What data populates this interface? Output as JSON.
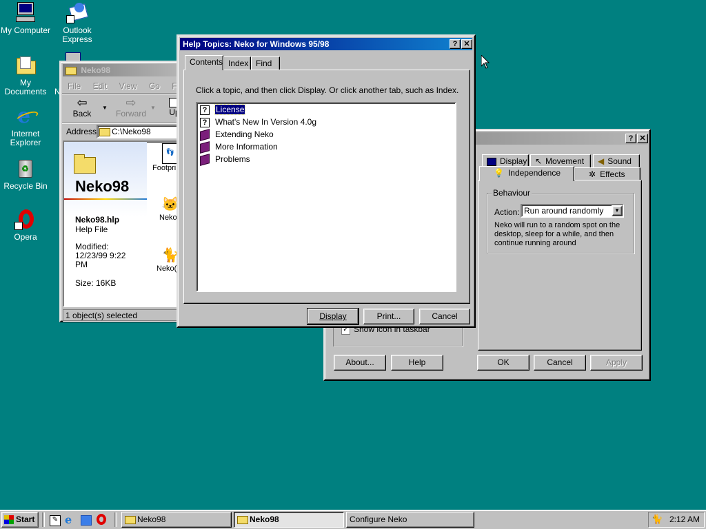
{
  "desktop": {
    "icons": [
      {
        "label": "My Computer",
        "icon": "my-computer-icon"
      },
      {
        "label": "Outlook Express",
        "icon": "outlook-express-icon"
      },
      {
        "label": "My Documents",
        "icon": "my-documents-icon"
      },
      {
        "label": "Internet Explorer",
        "icon": "internet-explorer-icon"
      },
      {
        "label": "Recycle Bin",
        "icon": "recycle-bin-icon"
      },
      {
        "label": "Opera",
        "icon": "opera-icon"
      }
    ],
    "partial_label": "N"
  },
  "explorer": {
    "title": "Neko98",
    "menu": [
      "File",
      "Edit",
      "View",
      "Go",
      "Favo"
    ],
    "toolbar": {
      "back": "Back",
      "forward": "Forward",
      "up": "Up"
    },
    "address_label": "Address",
    "address_value": "C:\\Neko98",
    "side_panel": {
      "folder_name": "Neko98",
      "file_name": "Neko98.hlp",
      "file_type": "Help File",
      "modified_label": "Modified:",
      "modified_value": "12/23/99 9:22 PM",
      "size": "Size: 16KB"
    },
    "files": [
      {
        "label": "Footpri",
        "icon": "footprints-file-icon"
      },
      {
        "label": "Neko",
        "icon": "neko-file-icon"
      },
      {
        "label": "Neko(",
        "icon": "neko-config-file-icon"
      }
    ],
    "status": "1 object(s) selected"
  },
  "help_dialog": {
    "title": "Help Topics: Neko for Windows 95/98",
    "tabs": [
      "Contents",
      "Index",
      "Find"
    ],
    "selected_tab": "Contents",
    "instruction": "Click a topic, and then click Display. Or click another tab, such as Index.",
    "topics": [
      {
        "label": "License",
        "icon": "question-page-icon",
        "selected": true
      },
      {
        "label": "What's New In Version 4.0g",
        "icon": "question-page-icon",
        "selected": false
      },
      {
        "label": "Extending Neko",
        "icon": "book-icon",
        "selected": false
      },
      {
        "label": "More Information",
        "icon": "book-icon",
        "selected": false
      },
      {
        "label": "Problems",
        "icon": "book-icon",
        "selected": false
      }
    ],
    "buttons": {
      "display": "Display",
      "print": "Print...",
      "cancel": "Cancel"
    },
    "title_buttons": {
      "help": "?",
      "close": "✕"
    }
  },
  "configure": {
    "title_buttons": {
      "help": "?",
      "close": "✕"
    },
    "tabs_row1": [
      "Display",
      "Movement",
      "Sound"
    ],
    "tabs_row2": [
      "Independence",
      "Effects"
    ],
    "selected_tab": "Independence",
    "group_label": "Behaviour",
    "action_label": "Action:",
    "action_value": "Run around randomly",
    "description": "Neko will run to a random spot on the desktop, sleep for a while, and then continue running around",
    "taskbar_checkbox_label": "Show icon in taskbar",
    "buttons": {
      "about": "About...",
      "help": "Help",
      "ok": "OK",
      "cancel": "Cancel",
      "apply": "Apply"
    }
  },
  "taskbar": {
    "start": "Start",
    "tasks": [
      {
        "label": "Neko98",
        "pressed": false
      },
      {
        "label": "Neko98",
        "pressed": true
      },
      {
        "label": "Configure Neko",
        "pressed": false
      }
    ],
    "time": "2:12 AM"
  },
  "colors": {
    "desktop": "#008080",
    "title_active": "#000080",
    "face": "#c0c0c0"
  }
}
